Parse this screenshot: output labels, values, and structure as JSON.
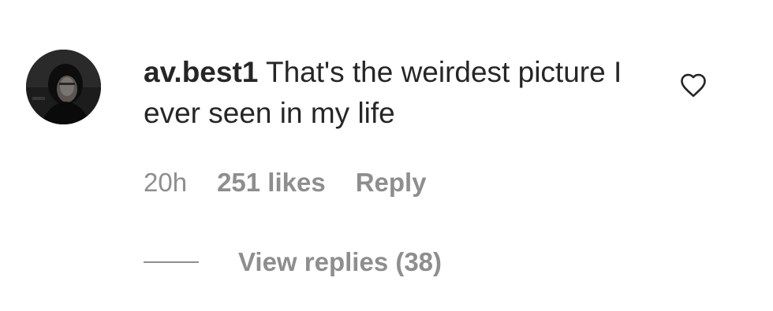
{
  "comment": {
    "avatar_icon": "user-avatar",
    "username": "av.best1",
    "text": " That's the weirdest picture I ever seen in my life",
    "like_icon": "heart-outline-icon",
    "time": "20h",
    "likes": "251 likes",
    "reply_label": "Reply",
    "view_replies_label": "View replies (38)"
  },
  "colors": {
    "text_primary": "#262626",
    "text_secondary": "#8e8e8e",
    "background": "#ffffff"
  }
}
